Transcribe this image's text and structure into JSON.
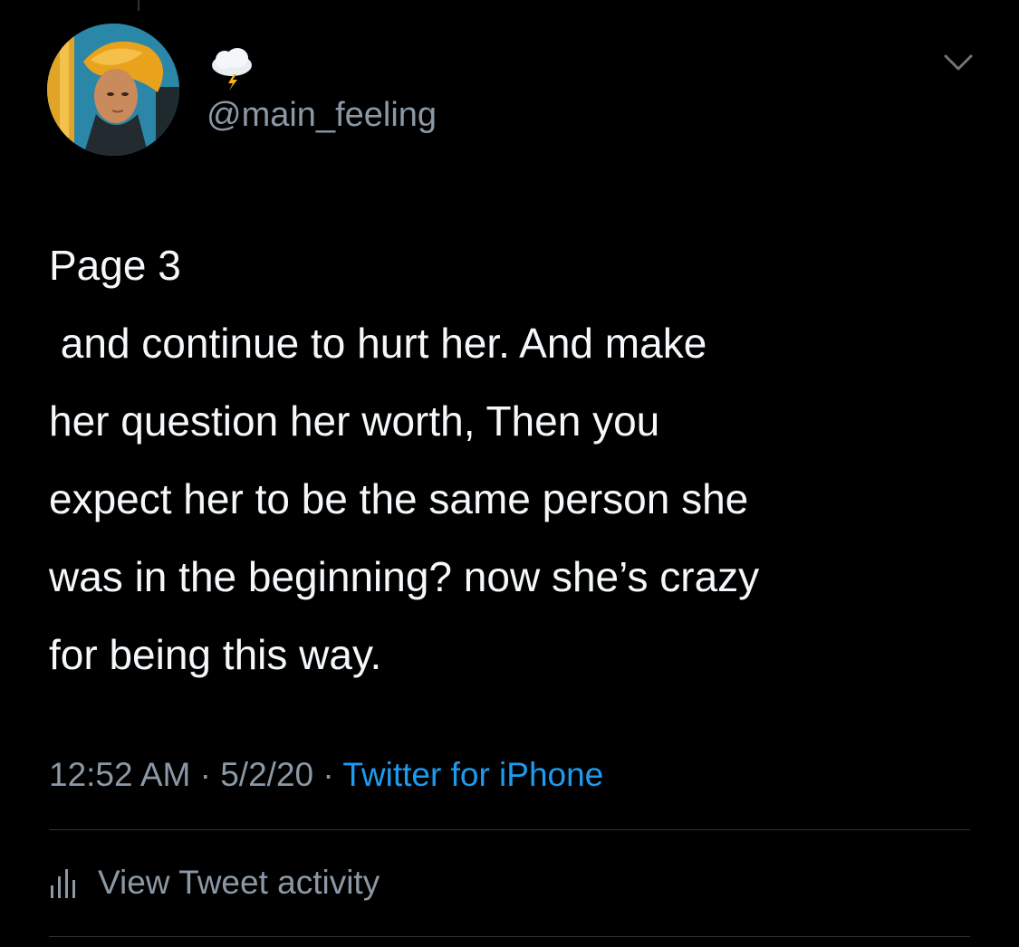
{
  "tweet": {
    "handle": "@main_feeling",
    "text_lines": [
      "Page 3",
      " and continue to hurt her. And make",
      "her question her worth, Then you",
      "expect her to be the same person she",
      "was in the beginning? now she’s crazy",
      "for being this way."
    ],
    "time": "12:52 AM",
    "separator": "·",
    "date": "5/2/20",
    "source": "Twitter for iPhone",
    "activity_label": "View Tweet activity"
  },
  "icons": {
    "name_emoji": "cloud-with-lightning-icon",
    "menu": "chevron-down-icon",
    "activity": "bar-chart-icon"
  },
  "colors": {
    "background": "#000000",
    "text": "#f5f8fa",
    "secondary": "#8b98a5",
    "link": "#1d9bf0",
    "divider": "#2f3336"
  }
}
